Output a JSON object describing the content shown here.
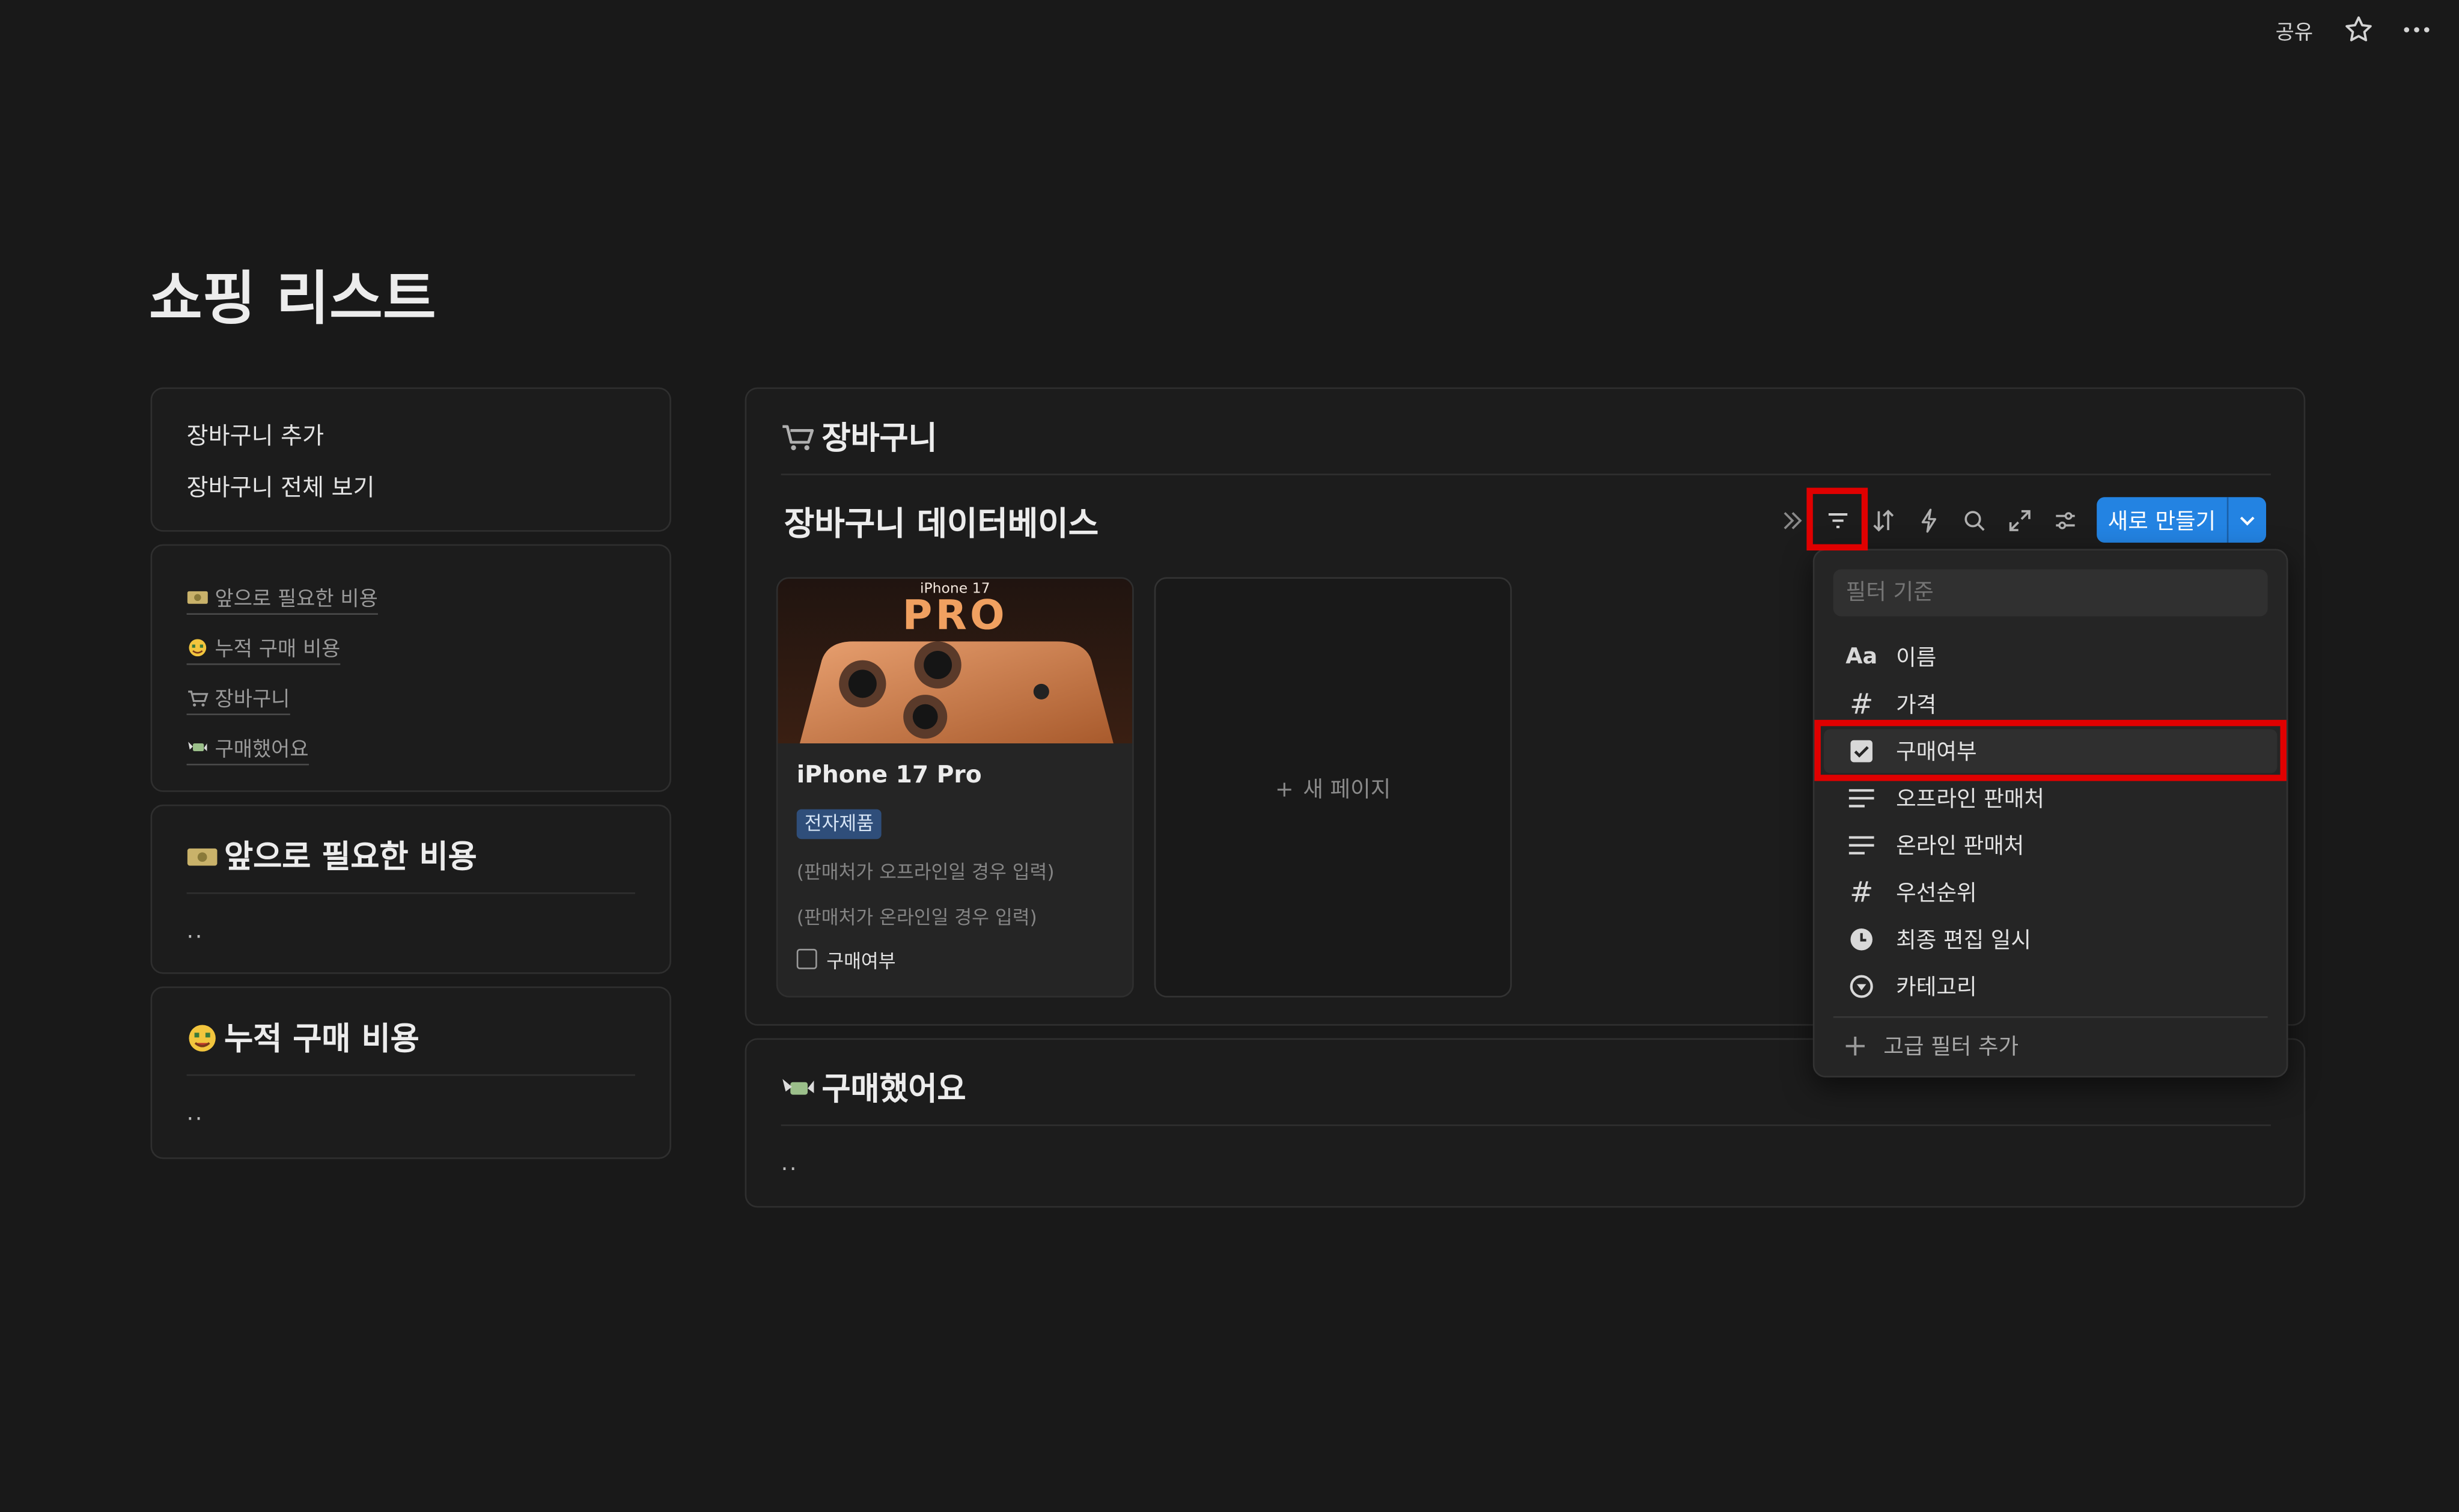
{
  "topbar": {
    "share_label": "공유",
    "star_icon": "star-icon",
    "more_icon": "more-horizontal-icon"
  },
  "page": {
    "title": "쇼핑 리스트"
  },
  "nav": {
    "items": [
      {
        "label": "장바구니 추가"
      },
      {
        "label": "장바구니 전체 보기"
      }
    ]
  },
  "toc": {
    "items": [
      {
        "icon": "money-icon",
        "label": "앞으로 필요한 비용"
      },
      {
        "icon": "money-face-icon",
        "label": "누적 구매 비용"
      },
      {
        "icon": "cart-icon",
        "label": "장바구니"
      },
      {
        "icon": "money-wings-icon",
        "label": "구매했어요"
      }
    ]
  },
  "future_cost": {
    "title": "앞으로 필요한 비용",
    "content": ".."
  },
  "total_cost": {
    "title": "누적 구매 비용",
    "content": ".."
  },
  "cart": {
    "title": "장바구니",
    "database_title": "장바구니 데이터베이스",
    "new_button_label": "새로 만들기",
    "toolbar_icons": [
      "collapse-icon",
      "filter-icon",
      "sort-icon",
      "automation-icon",
      "search-icon",
      "expand-icon",
      "settings-icon"
    ],
    "product": {
      "image_caption": "iPhone 17",
      "image_text": "PRO",
      "name": "iPhone 17 Pro",
      "tag": "전자제품",
      "tag_color": "#2f4e7a",
      "offline_hint": "(판매처가 오프라인일 경우 입력)",
      "online_hint": "(판매처가 온라인일 경우 입력)",
      "purchased_label": "구매여부",
      "purchased": false
    },
    "new_page_label": "새 페이지"
  },
  "filter_menu": {
    "placeholder": "필터 기준",
    "items": [
      {
        "icon": "text-icon",
        "icon_text": "Aa",
        "label": "이름"
      },
      {
        "icon": "number-icon",
        "icon_text": "#",
        "label": "가격"
      },
      {
        "icon": "checkbox-icon",
        "icon_text": "",
        "label": "구매여부",
        "highlighted": true
      },
      {
        "icon": "lines-icon",
        "icon_text": "",
        "label": "오프라인 판매처"
      },
      {
        "icon": "lines-icon",
        "icon_text": "",
        "label": "온라인 판매처"
      },
      {
        "icon": "number-icon",
        "icon_text": "#",
        "label": "우선순위"
      },
      {
        "icon": "clock-icon",
        "icon_text": "",
        "label": "최종 편집 일시"
      },
      {
        "icon": "select-icon",
        "icon_text": "",
        "label": "카테고리"
      }
    ],
    "advanced_label": "고급 필터 추가"
  },
  "purchased": {
    "title": "구매했어요",
    "content": ".."
  },
  "colors": {
    "background": "#191919",
    "accent": "#2383e2",
    "highlight_box": "#e00000"
  }
}
